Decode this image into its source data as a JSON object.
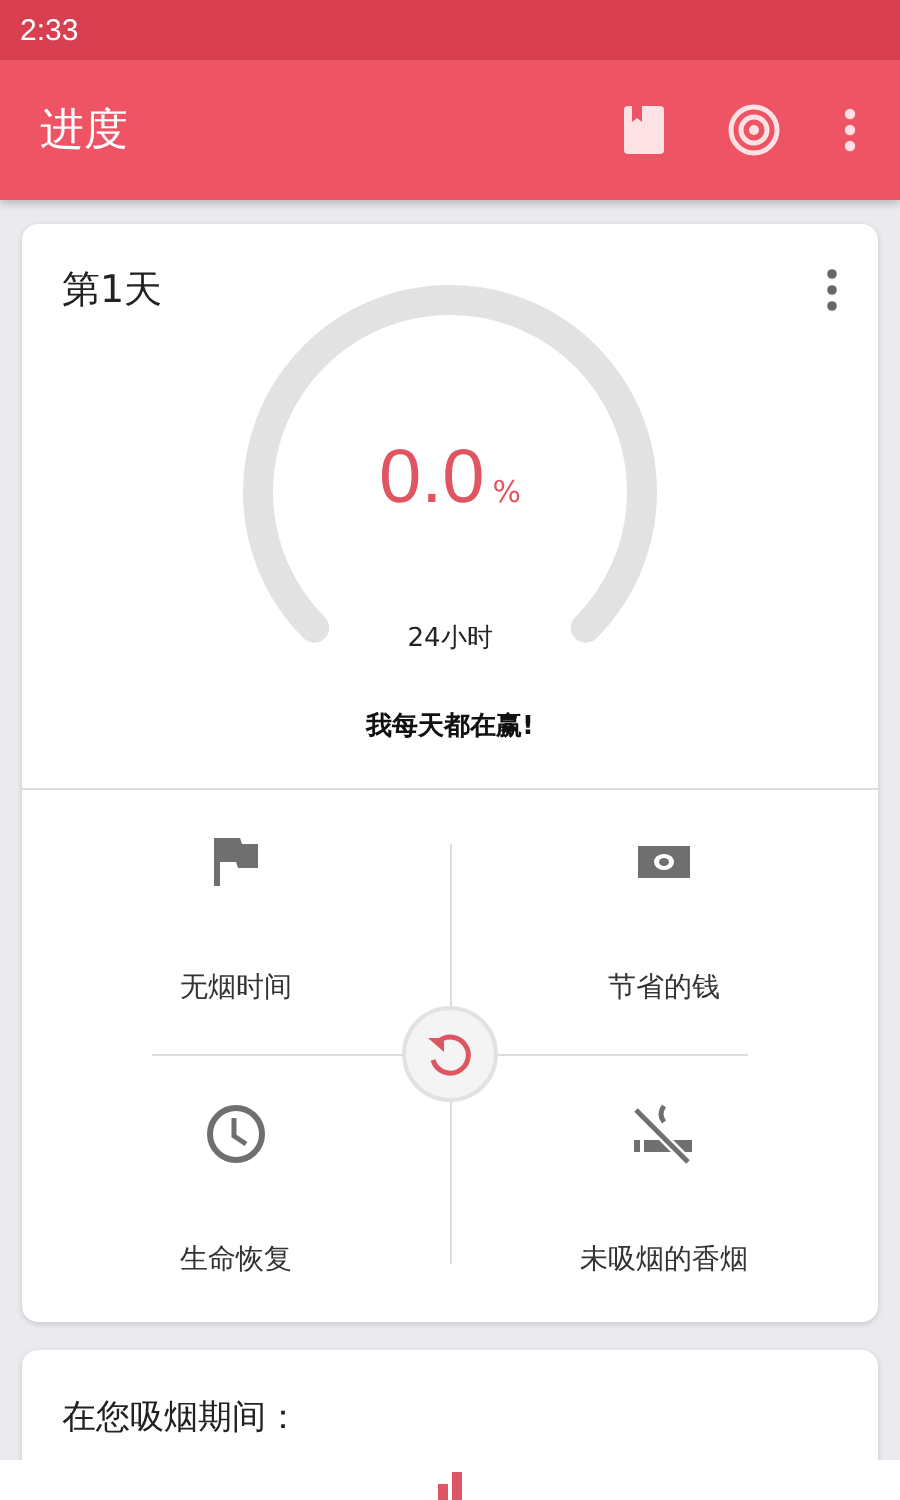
{
  "status_bar": {
    "time": "2:33"
  },
  "app_bar": {
    "title": "进度"
  },
  "progress_card": {
    "day": "第1天",
    "gauge": {
      "value": "0.0",
      "unit": "%",
      "caption": "24小时"
    },
    "motto": "我每天都在赢!"
  },
  "stats": [
    {
      "kind": "flag",
      "label": "无烟时间"
    },
    {
      "kind": "money",
      "label": "节省的钱"
    },
    {
      "kind": "clock",
      "label": "生命恢复"
    },
    {
      "kind": "nosmoke",
      "label": "未吸烟的香烟"
    }
  ],
  "next_card": {
    "title": "在您吸烟期间："
  }
}
